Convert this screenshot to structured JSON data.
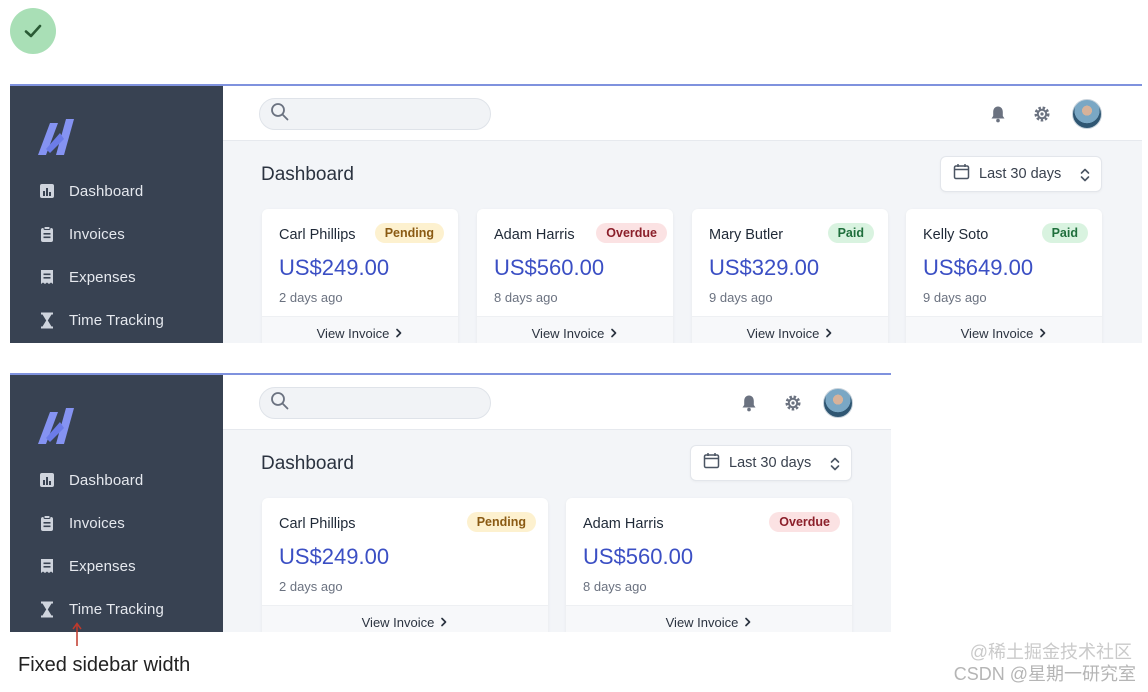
{
  "app": {
    "title": "Dashboard",
    "date_filter": "Last 30 days"
  },
  "nav": [
    {
      "label": "Dashboard",
      "icon": "chart-icon"
    },
    {
      "label": "Invoices",
      "icon": "invoice-icon"
    },
    {
      "label": "Expenses",
      "icon": "receipt-icon"
    },
    {
      "label": "Time Tracking",
      "icon": "hourglass-icon"
    }
  ],
  "invoices": [
    {
      "name": "Carl Phillips",
      "status": "Pending",
      "amount": "US$249.00",
      "time": "2 days ago",
      "action": "View Invoice"
    },
    {
      "name": "Adam Harris",
      "status": "Overdue",
      "amount": "US$560.00",
      "time": "8 days ago",
      "action": "View Invoice"
    },
    {
      "name": "Mary Butler",
      "status": "Paid",
      "amount": "US$329.00",
      "time": "9 days ago",
      "action": "View Invoice"
    },
    {
      "name": "Kelly Soto",
      "status": "Paid",
      "amount": "US$649.00",
      "time": "9 days ago",
      "action": "View Invoice"
    }
  ],
  "annotation": "Fixed sidebar width",
  "watermark": "CSDN @星期一研究室",
  "watermark_top": "@稀土掘金技术社区",
  "colors": {
    "sidebar": "#384252",
    "accent": "#3b4fc4",
    "frame_border": "#7f92de",
    "success_check": "#a9dfb6"
  }
}
